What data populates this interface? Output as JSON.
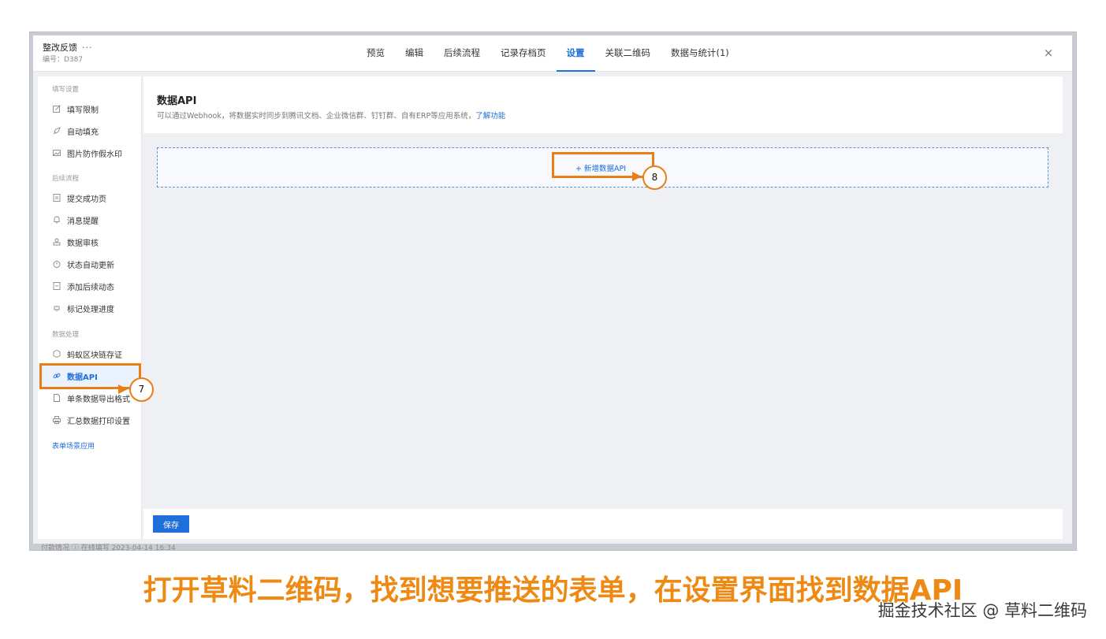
{
  "header": {
    "form_title": "整改反馈",
    "more": "···",
    "form_id": "编号：D387",
    "tabs": [
      {
        "label": "预览"
      },
      {
        "label": "编辑"
      },
      {
        "label": "后续流程"
      },
      {
        "label": "记录存档页"
      },
      {
        "label": "设置",
        "active": true
      },
      {
        "label": "关联二维码"
      },
      {
        "label": "数据与统计(1)"
      }
    ],
    "close": "×"
  },
  "sidebar": {
    "sections": [
      {
        "label": "填写设置",
        "items": [
          {
            "label": "填写限制",
            "icon": "edit-icon"
          },
          {
            "label": "自动填充",
            "icon": "rocket-icon"
          },
          {
            "label": "图片防作假水印",
            "icon": "image-icon"
          }
        ]
      },
      {
        "label": "后续流程",
        "items": [
          {
            "label": "提交成功页",
            "icon": "document-icon"
          },
          {
            "label": "消息提醒",
            "icon": "bell-icon"
          },
          {
            "label": "数据审核",
            "icon": "stamp-icon"
          },
          {
            "label": "状态自动更新",
            "icon": "timer-icon"
          },
          {
            "label": "添加后续动态",
            "icon": "note-icon"
          },
          {
            "label": "标记处理进度",
            "icon": "refresh-icon"
          }
        ]
      },
      {
        "label": "数据处理",
        "items": [
          {
            "label": "蚂蚁区块链存证",
            "icon": "blockchain-icon"
          },
          {
            "label": "数据API",
            "icon": "link-icon",
            "active": true
          },
          {
            "label": "单条数据导出格式",
            "icon": "file-icon"
          },
          {
            "label": "汇总数据打印设置",
            "icon": "printer-icon"
          }
        ]
      }
    ],
    "scenario_link": "表单场景应用"
  },
  "main": {
    "title": "数据API",
    "desc": "可以通过Webhook，将数据实时同步到腾讯文档、企业微信群、钉钉群、自有ERP等应用系统，",
    "learn_more": "了解功能",
    "add_button": "+ 新增数据API",
    "save_button": "保存"
  },
  "background_strip": "付款情况   ⓘ 在线填写   2023-04-14 16:34",
  "annotations": {
    "step_7": "7",
    "step_8": "8",
    "color": "#ea7d16"
  },
  "caption": "打开草料二维码，找到想要推送的表单，在设置界面找到数据API",
  "watermark": "掘金技术社区 @ 草料二维码"
}
